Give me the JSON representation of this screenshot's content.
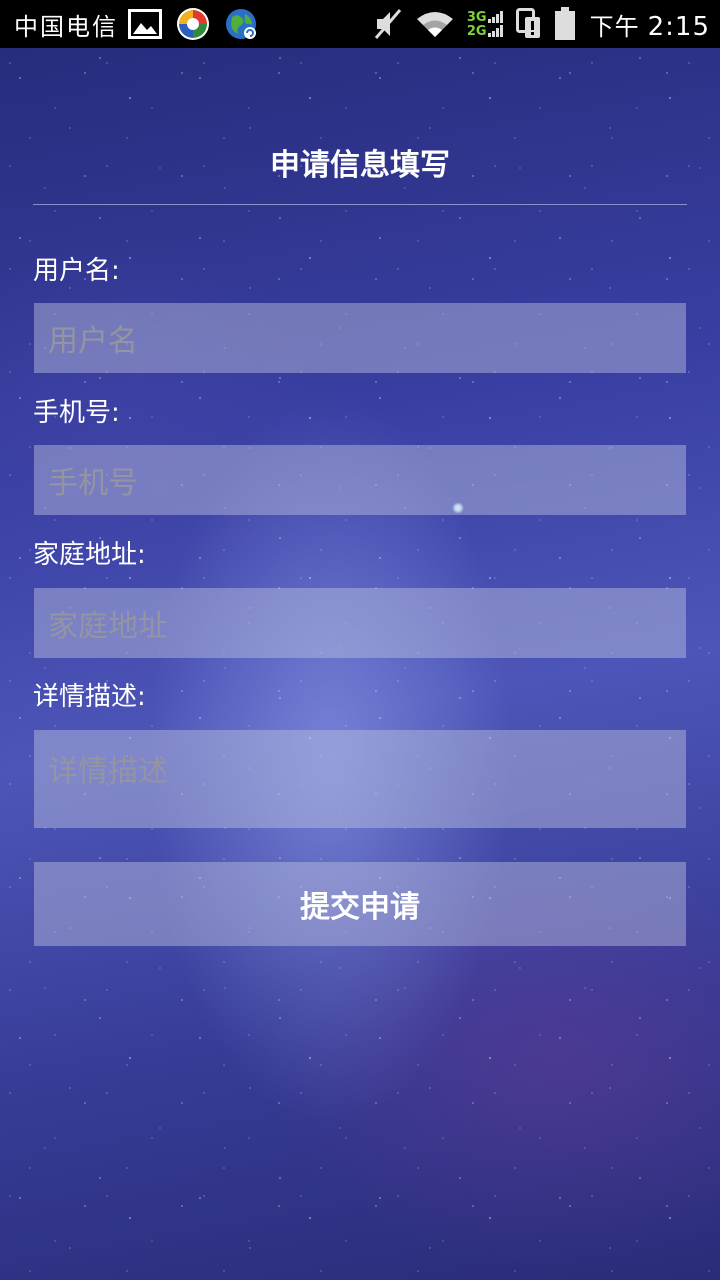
{
  "status_bar": {
    "carrier": "中国电信",
    "network_top": "3G",
    "network_bottom": "2G",
    "ampm": "下午",
    "time": "2:15",
    "icons": [
      "gallery-icon",
      "app-icon",
      "browser-icon",
      "mute-icon",
      "wifi-icon",
      "signal-icon",
      "sim-icon",
      "battery-icon"
    ]
  },
  "form": {
    "title": "申请信息填写",
    "fields": [
      {
        "label": "用户名:",
        "placeholder": "用户名"
      },
      {
        "label": "手机号:",
        "placeholder": "手机号"
      },
      {
        "label": "家庭地址:",
        "placeholder": "家庭地址"
      },
      {
        "label": "详情描述:",
        "placeholder": "详情描述"
      }
    ],
    "submit_label": "提交申请"
  },
  "colors": {
    "background": "#3a40a4",
    "field_background": "rgba(190,195,225,0.45)",
    "text": "#ffffff",
    "placeholder": "#969696"
  }
}
